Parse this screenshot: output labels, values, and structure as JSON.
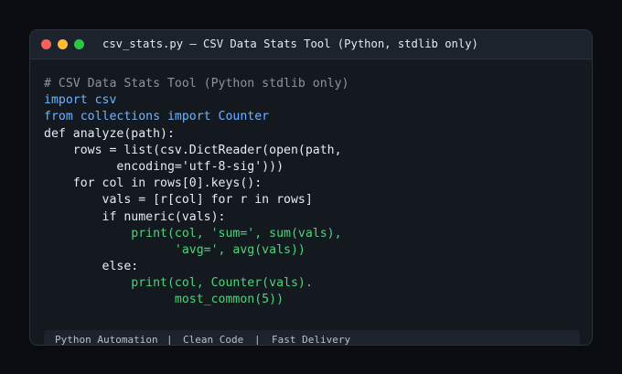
{
  "window": {
    "title": "csv_stats.py — CSV Data Stats Tool (Python, stdlib only)"
  },
  "colors": {
    "close": "#ff5f57",
    "minimize": "#febc2e",
    "maximize": "#28c840",
    "comment": "#8b939d",
    "keyword": "#6eb3ff",
    "call": "#4fd27d",
    "text": "#e8ebef"
  },
  "code": {
    "lines": [
      {
        "text": "# CSV Data Stats Tool (Python stdlib only)",
        "kind": "comment"
      },
      {
        "text": "import csv",
        "kind": "keyword"
      },
      {
        "text": "from collections import Counter",
        "kind": "keyword"
      },
      {
        "text": "def analyze(path):",
        "kind": "plain"
      },
      {
        "text": "    rows = list(csv.DictReader(open(path,",
        "kind": "plain"
      },
      {
        "text": "          encoding='utf-8-sig')))",
        "kind": "plain"
      },
      {
        "text": "    for col in rows[0].keys():",
        "kind": "plain"
      },
      {
        "text": "        vals = [r[col] for r in rows]",
        "kind": "plain"
      },
      {
        "text": "        if numeric(vals):",
        "kind": "plain"
      },
      {
        "text": "            print(col, 'sum=', sum(vals),",
        "kind": "call"
      },
      {
        "text": "                  'avg=', avg(vals))",
        "kind": "call"
      },
      {
        "text": "        else:",
        "kind": "plain"
      },
      {
        "text": "            print(col, Counter(vals).",
        "kind": "call"
      },
      {
        "text": "                  most_common(5))",
        "kind": "call"
      }
    ]
  },
  "footer": {
    "items": [
      "Python Automation",
      "Clean Code",
      "Fast Delivery"
    ],
    "separator": "|"
  }
}
